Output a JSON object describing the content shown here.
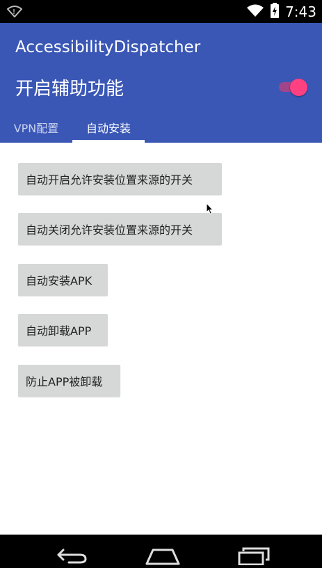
{
  "status_bar": {
    "time": "7:43",
    "icons": [
      "signal-off-icon",
      "wifi-icon",
      "battery-charging-icon"
    ]
  },
  "app_bar": {
    "title": "AccessibilityDispatcher",
    "switch_label": "开启辅助功能",
    "switch_on": true,
    "colors": {
      "primary": "#3a57b6",
      "accent": "#ff4081"
    }
  },
  "tabs": [
    {
      "label": "VPN配置",
      "selected": false
    },
    {
      "label": "自动安装",
      "selected": true
    }
  ],
  "buttons": [
    {
      "label": "自动开启允许安装位置来源的开关"
    },
    {
      "label": "自动关闭允许安装位置来源的开关"
    },
    {
      "label": "自动安装APK"
    },
    {
      "label": "自动卸载APP"
    },
    {
      "label": "防止APP被卸载"
    }
  ],
  "nav_bar": {
    "icons": [
      "back-icon",
      "home-icon",
      "recents-icon"
    ]
  }
}
